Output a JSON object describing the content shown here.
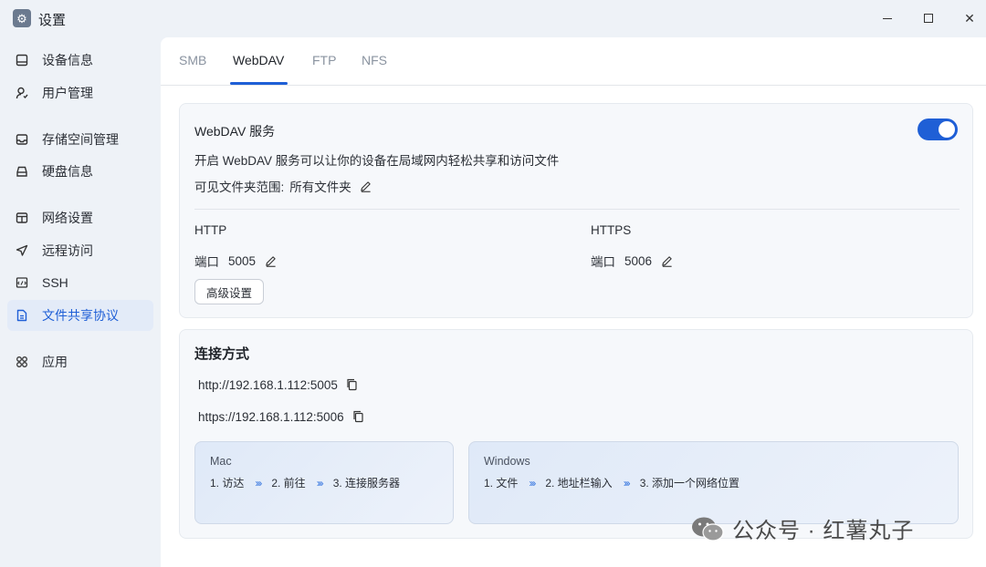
{
  "window": {
    "title": "设置",
    "app_icon": "gear-icon"
  },
  "sidebar": {
    "items": [
      {
        "label": "设备信息",
        "icon": "device-icon"
      },
      {
        "label": "用户管理",
        "icon": "user-icon"
      },
      {
        "label": "存储空间管理",
        "icon": "storage-icon"
      },
      {
        "label": "硬盘信息",
        "icon": "disk-icon"
      },
      {
        "label": "网络设置",
        "icon": "network-icon"
      },
      {
        "label": "远程访问",
        "icon": "remote-icon"
      },
      {
        "label": "SSH",
        "icon": "ssh-icon"
      },
      {
        "label": "文件共享协议",
        "icon": "file-share-icon",
        "active": true
      },
      {
        "label": "应用",
        "icon": "apps-icon"
      }
    ]
  },
  "tabs": [
    {
      "label": "SMB"
    },
    {
      "label": "WebDAV",
      "active": true
    },
    {
      "label": "FTP"
    },
    {
      "label": "NFS"
    }
  ],
  "service": {
    "title": "WebDAV 服务",
    "enabled": true,
    "description": "开启 WebDAV 服务可以让你的设备在局域网内轻松共享和访问文件",
    "scope_label": "可见文件夹范围:",
    "scope_value": "所有文件夹",
    "http": {
      "label": "HTTP",
      "port_label": "端口",
      "port": "5005"
    },
    "https": {
      "label": "HTTPS",
      "port_label": "端口",
      "port": "5006"
    },
    "advanced_button": "高级设置"
  },
  "connection": {
    "title": "连接方式",
    "urls": [
      "http://192.168.1.112:5005",
      "https://192.168.1.112:5006"
    ],
    "mac": {
      "name": "Mac",
      "steps": [
        "1. 访达",
        "2. 前往",
        "3. 连接服务器"
      ]
    },
    "windows": {
      "name": "Windows",
      "steps": [
        "1. 文件",
        "2. 地址栏输入",
        "3. 添加一个网络位置"
      ]
    }
  },
  "watermark": "公众号 · 红薯丸子",
  "colors": {
    "accent": "#1f5fd6",
    "sidebar_active_bg": "#e3ebf8",
    "background": "#eef2f7"
  }
}
